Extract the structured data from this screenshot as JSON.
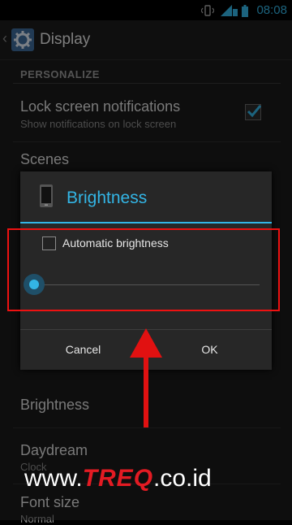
{
  "status_bar": {
    "time": "08:08",
    "icons": [
      "vibrate-icon",
      "signal-icon",
      "signal-icon",
      "battery-icon"
    ]
  },
  "action_bar": {
    "title": "Display",
    "icon": "settings-gear-icon"
  },
  "settings": {
    "section_header": "PERSONALIZE",
    "lock_screen": {
      "title": "Lock screen notifications",
      "subtitle": "Show notifications on lock screen",
      "checked": true
    },
    "scenes": {
      "title": "Scenes"
    },
    "brightness": {
      "title": "Brightness"
    },
    "daydream": {
      "title": "Daydream",
      "subtitle": "Clock"
    },
    "font_size": {
      "title": "Font size",
      "subtitle": "Normal"
    }
  },
  "dialog": {
    "title": "Brightness",
    "icon": "phone-icon",
    "auto_brightness_label": "Automatic brightness",
    "auto_brightness_checked": false,
    "slider_level": 0,
    "cancel_label": "Cancel",
    "ok_label": "OK"
  },
  "annotation": {
    "highlight_color": "#e11111",
    "arrow_color": "#e11111"
  },
  "watermark": {
    "prefix": "www.",
    "brand": "TREQ",
    "suffix": ".co.id"
  },
  "colors": {
    "accent": "#33b5e5"
  }
}
